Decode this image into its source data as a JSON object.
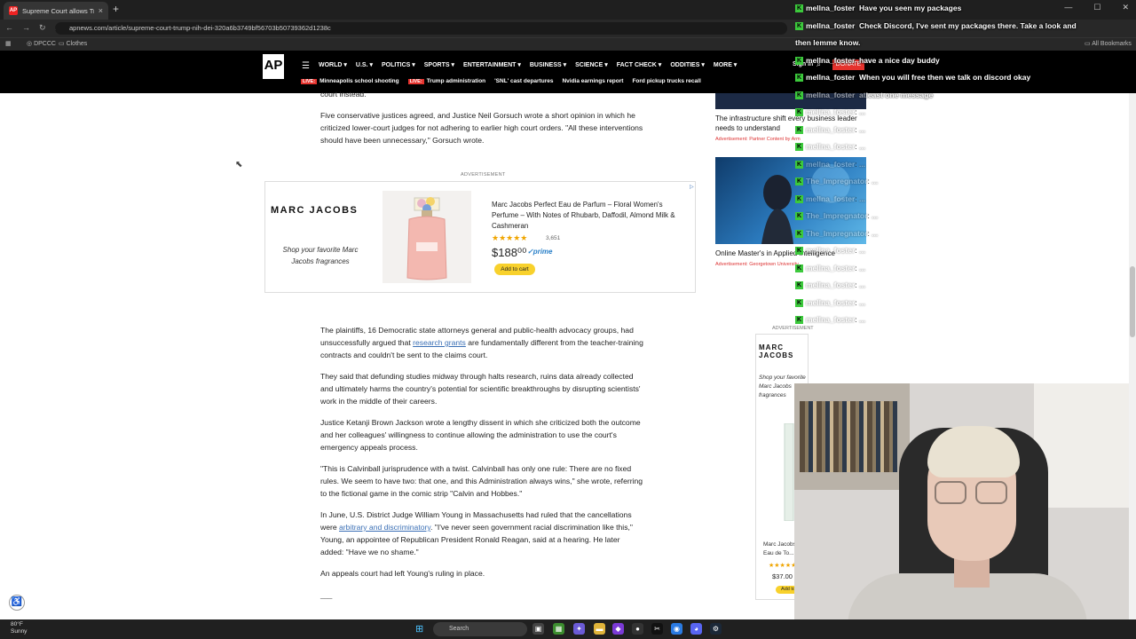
{
  "browser": {
    "tab_title": "Supreme Court allows Trump to",
    "tab_close": "×",
    "new_tab": "+",
    "url": "apnews.com/article/supreme-court-trump-nih-dei-320a6b3749bf56703b50739362d1238c",
    "bookmarks": [
      {
        "label": "DPCCC"
      },
      {
        "label": "Clothes"
      },
      {
        "label": "All Bookmarks"
      }
    ],
    "window_controls": [
      "—",
      "☐",
      "✕"
    ]
  },
  "ap": {
    "logo": "AP",
    "nav": [
      "WORLD",
      "U.S.",
      "POLITICS",
      "SPORTS",
      "ENTERTAINMENT",
      "BUSINESS",
      "SCIENCE",
      "FACT CHECK",
      "ODDITIES",
      "MORE"
    ],
    "sign_in": "Sign in",
    "donate": "DONATE",
    "live_label": "LIVE:",
    "trending": [
      {
        "live": true,
        "label": "Minneapolis school shooting"
      },
      {
        "live": true,
        "label": "Trump administration"
      },
      {
        "live": false,
        "label": "'SNL' cast departures"
      },
      {
        "live": false,
        "label": "Nvidia earnings report"
      },
      {
        "live": false,
        "label": "Ford pickup trucks recall"
      }
    ]
  },
  "article": {
    "p0": "court instead.",
    "p1": "Five conservative justices agreed, and Justice Neil Gorsuch wrote a short opinion in which he criticized lower-court judges for not adhering to earlier high court orders. \"All these interventions should have been unnecessary,\" Gorsuch wrote.",
    "ad_label": "ADVERTISEMENT",
    "p2_a": "The plaintiffs, 16 Democratic state attorneys general and public-health advocacy groups, had unsuccessfully argued that ",
    "p2_link": "research grants",
    "p2_b": " are fundamentally different from the teacher-training contracts and couldn't be sent to the claims court.",
    "p3": "They said that defunding studies midway through halts research, ruins data already collected and ultimately harms the country's potential for scientific breakthroughs by disrupting scientists' work in the middle of their careers.",
    "p4": "Justice Ketanji Brown Jackson wrote a lengthy dissent in which she criticized both the outcome and her colleagues' willingness to continue allowing the administration to use the court's emergency appeals process.",
    "p5": "\"This is Calvinball jurisprudence with a twist. Calvinball has only one rule: There are no fixed rules. We seem to have two: that one, and this Administration always wins,\" she wrote, referring to the fictional game in the comic strip \"Calvin and Hobbes.\"",
    "p6_a": "In June, U.S. District Judge William Young in Massachusetts had ruled that the cancellations were ",
    "p6_link": "arbitrary and discriminatory",
    "p6_b": ". \"I've never seen government racial discrimination like this,\" Young, an appointee of Republican President Ronald Reagan, said at a hearing. He later added: \"Have we no shame.\"",
    "p7": "An appeals court had left Young's ruling in place.",
    "end_mark": "___"
  },
  "ad": {
    "brand": "MARC JACOBS",
    "tagline": "Shop your favorite Marc Jacobs fragrances",
    "title": "Marc Jacobs Perfect Eau de Parfum – Floral Women's Perfume – With Notes of Rhubarb, Daffodil, Almond Milk & Cashmeran",
    "stars": "★★★★★",
    "rating_count": "3,651",
    "price": "$188⁰⁰",
    "prime": "✓prime",
    "add_to_cart": "Add to cart",
    "adchoice": "▷"
  },
  "sidebar": {
    "card1_title": "The infrastructure shift every business leader needs to understand",
    "card1_source": "Advertisement: Partner Content by Arm",
    "card2_title": "Online Master's in Applied Intelligence",
    "card2_source": "Advertisement: Georgetown University",
    "ad_label": "ADVERTISEMENT",
    "ad2_brand": "MARC JACOBS",
    "ad2_tagline": "Shop your favorite Marc Jacobs fragrances",
    "ad2_product": "Marc Jacobs Eau de To...",
    "ad2_stars": "★★★★★",
    "ad2_price": "$37.00",
    "ad2_cart": "Add to"
  },
  "chat": [
    {
      "user": "mellna_foster",
      "text": "Have you seen my packages",
      "fade": 0
    },
    {
      "user": "mellna_foster",
      "text": "Check Discord, I've sent my packages there. Take a look and",
      "fade": 0
    },
    {
      "user": "",
      "text": "then lemme know.",
      "fade": 0
    },
    {
      "user": "mellna_foster",
      "text": "have a nice day buddy",
      "fade": 0
    },
    {
      "user": "mellna_foster",
      "text": "When you will free then we talk on discord okay",
      "fade": 0
    },
    {
      "user": "mellna_foster",
      "text": "atleast one message",
      "fade": 1
    },
    {
      "user": "mellna_foster",
      "text": "...",
      "fade": 2
    },
    {
      "user": "mellna_foster",
      "text": "...",
      "fade": 2
    },
    {
      "user": "mellna_foster",
      "text": "...",
      "fade": 2
    },
    {
      "user": "mellna_foster",
      "text": "...",
      "fade": 2
    },
    {
      "user": "The_Impregnator",
      "text": "...",
      "fade": 2
    },
    {
      "user": "mellna_foster",
      "text": "...",
      "fade": 2
    },
    {
      "user": "The_Impregnator",
      "text": "...",
      "fade": 2
    },
    {
      "user": "The_Impregnator",
      "text": "...",
      "fade": 2
    },
    {
      "user": "mellna_foster",
      "text": "...",
      "fade": 2
    },
    {
      "user": "mellna_foster",
      "text": "...",
      "fade": 2
    },
    {
      "user": "mellna_foster",
      "text": "...",
      "fade": 2
    },
    {
      "user": "mellna_foster",
      "text": "...",
      "fade": 2
    },
    {
      "user": "mellna_foster",
      "text": "...",
      "fade": 2
    }
  ],
  "taskbar": {
    "weather_temp": "80°F",
    "weather_desc": "Sunny",
    "search": "Search"
  }
}
